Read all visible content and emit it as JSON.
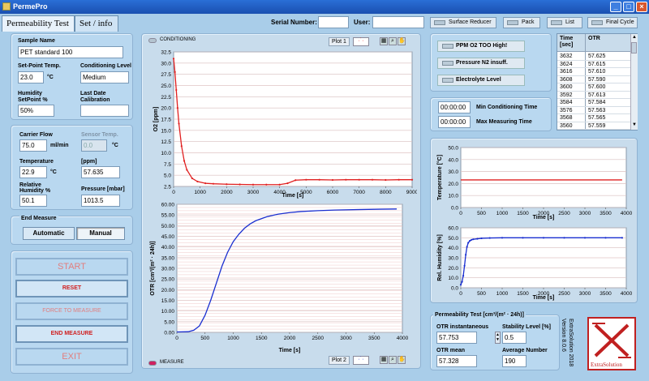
{
  "window": {
    "title": "PermePro"
  },
  "tabs": [
    {
      "label": "Permeability Test"
    },
    {
      "label": "Set / info"
    }
  ],
  "header": {
    "serial_label": "Serial Number:",
    "serial_value": "",
    "user_label": "User:",
    "user_value": "",
    "buttons": [
      {
        "label": "Surface Reducer"
      },
      {
        "label": "Pack"
      },
      {
        "label": "List"
      },
      {
        "label": "Final Cycle"
      }
    ]
  },
  "sample": {
    "name_label": "Sample Name",
    "name_value": "PET standard 100",
    "setpoint_label": "Set-Point Temp.",
    "setpoint_value": "23.0",
    "setpoint_unit": "°C",
    "cond_label": "Conditioning Level",
    "cond_value": "Medium",
    "humidity_label_1": "Humidity",
    "humidity_label_2": "SetPoint %",
    "humidity_value": "50%",
    "lastdate_label_1": "Last Date",
    "lastdate_label_2": "Calibration",
    "lastdate_value": ""
  },
  "carrier": {
    "flow_label": "Carrier Flow",
    "flow_value": "75.0",
    "flow_unit": "ml/min",
    "sensor_label": "Sensor Temp.",
    "sensor_value": "0.0",
    "sensor_unit": "°C",
    "temp_label": "Temperature",
    "temp_value": "22.9",
    "temp_unit": "°C",
    "ppm_label": "[ppm]",
    "ppm_value": "57.635",
    "rh_label_1": "Relative",
    "rh_label_2": "Humidity %",
    "rh_value": "50.1",
    "pressure_label": "Pressure [mbar]",
    "pressure_value": "1013.5"
  },
  "end_measure": {
    "title": "End Measure",
    "automatic": "Automatic",
    "manual": "Manual"
  },
  "actions": {
    "start": "START",
    "reset": "RESET",
    "force": "FORCE TO MEASURE",
    "end": "END MEASURE",
    "exit": "EXIT"
  },
  "plots": {
    "top_status": "CONDITIONING",
    "top_plot_label": "Plot 1",
    "bottom_status": "MEASURE",
    "bottom_plot_label": "Plot 2"
  },
  "alarms": [
    {
      "label": "PPM O2 TOO High!"
    },
    {
      "label": "Pressure N2 insuff."
    },
    {
      "label": "Electrolyte Level"
    }
  ],
  "times": {
    "min_cond_value": "00:00:00",
    "min_cond_label": "Min Conditioning Time",
    "max_meas_value": "00:00:00",
    "max_meas_label": "Max Measuring Time"
  },
  "otr_table": {
    "col_time_1": "Time",
    "col_time_2": "[sec]",
    "col_otr": "OTR",
    "rows": [
      [
        "3632",
        "57.625"
      ],
      [
        "3624",
        "57.615"
      ],
      [
        "3616",
        "57.610"
      ],
      [
        "3608",
        "57.590"
      ],
      [
        "3600",
        "57.600"
      ],
      [
        "3592",
        "57.613"
      ],
      [
        "3584",
        "57.584"
      ],
      [
        "3576",
        "57.563"
      ],
      [
        "3568",
        "57.565"
      ],
      [
        "3560",
        "57.559"
      ]
    ]
  },
  "result": {
    "title": "Permeability Test [cm³/(m² · 24h)]",
    "otr_inst_label": "OTR instantaneous",
    "otr_inst_value": "57.753",
    "stability_label": "Stability Level [%]",
    "stability_value": "0.5",
    "otr_mean_label": "OTR mean",
    "otr_mean_value": "57.328",
    "avg_label": "Average Number",
    "avg_value": "190"
  },
  "brand": {
    "name": "ExtraSolution",
    "version_text": "ExtraSolution 2018",
    "version_num": "Version 8.0.6"
  },
  "chart_data": [
    {
      "type": "scatter",
      "title": "",
      "xlabel": "Time [s]",
      "ylabel": "O2 [ppm]",
      "xlim": [
        0,
        9000
      ],
      "ylim": [
        2.5,
        32.5
      ],
      "xticks": [
        0,
        1000,
        2000,
        3000,
        4000,
        5000,
        6000,
        7000,
        8000,
        9000
      ],
      "yticks": [
        2.5,
        5.0,
        7.5,
        10.0,
        12.5,
        15.0,
        17.5,
        20.0,
        22.5,
        25.0,
        27.5,
        30.0,
        32.5
      ],
      "color": "#e02020",
      "x": [
        0,
        50,
        100,
        150,
        200,
        300,
        400,
        500,
        700,
        900,
        1200,
        1500,
        2000,
        2500,
        3000,
        3500,
        4000,
        4300,
        4600,
        5000,
        5500,
        6000,
        6500,
        7000,
        7500,
        8000,
        8500,
        9000
      ],
      "y": [
        31.0,
        28.0,
        24.0,
        20.0,
        16.5,
        11.5,
        8.2,
        6.2,
        4.3,
        3.6,
        3.2,
        3.1,
        3.0,
        2.95,
        2.9,
        2.9,
        2.9,
        3.2,
        3.9,
        4.0,
        4.0,
        3.95,
        4.0,
        4.0,
        4.0,
        3.95,
        4.0,
        4.0
      ]
    },
    {
      "type": "line",
      "title": "",
      "xlabel": "Time [s]",
      "ylabel": "OTR [cm³/(m² · 24h)]",
      "xlim": [
        0,
        4000
      ],
      "ylim": [
        0,
        60
      ],
      "xticks": [
        0,
        500,
        1000,
        1500,
        2000,
        2500,
        3000,
        3500,
        4000
      ],
      "yticks": [
        0.0,
        5.0,
        10.0,
        15.0,
        20.0,
        25.0,
        30.0,
        35.0,
        40.0,
        45.0,
        50.0,
        55.0,
        60.0
      ],
      "color": "#1a2fd0",
      "x": [
        0,
        200,
        300,
        400,
        500,
        600,
        700,
        800,
        900,
        1000,
        1100,
        1200,
        1300,
        1400,
        1600,
        1800,
        2000,
        2200,
        2500,
        2800,
        3200,
        3600,
        3900
      ],
      "y": [
        0.2,
        0.3,
        1.0,
        3.0,
        8.0,
        15.0,
        23.0,
        31.0,
        37.5,
        42.5,
        46.0,
        48.8,
        50.8,
        52.3,
        54.2,
        55.4,
        56.1,
        56.6,
        57.0,
        57.3,
        57.5,
        57.7,
        57.8
      ]
    },
    {
      "type": "line",
      "title": "",
      "xlabel": "Time [s]",
      "ylabel": "Temperature [°C]",
      "xlim": [
        0,
        4000
      ],
      "ylim": [
        0,
        50
      ],
      "xticks": [
        0,
        500,
        1000,
        1500,
        2000,
        2500,
        3000,
        3500,
        4000
      ],
      "yticks": [
        0.0,
        10.0,
        20.0,
        30.0,
        40.0,
        50.0
      ],
      "color": "#e02020",
      "x": [
        0,
        3900
      ],
      "y": [
        23.0,
        23.0
      ]
    },
    {
      "type": "scatter",
      "title": "",
      "xlabel": "Time [s]",
      "ylabel": "Rel. Humidity [%]",
      "xlim": [
        0,
        4000
      ],
      "ylim": [
        0,
        60
      ],
      "xticks": [
        0,
        500,
        1000,
        1500,
        2000,
        2500,
        3000,
        3500,
        4000
      ],
      "yticks": [
        0.0,
        10.0,
        20.0,
        30.0,
        40.0,
        50.0,
        60.0
      ],
      "color": "#1a2fd0",
      "x": [
        0,
        30,
        60,
        90,
        120,
        150,
        180,
        220,
        260,
        300,
        400,
        500,
        700,
        1000,
        1500,
        2000,
        2500,
        3000,
        3500,
        3900
      ],
      "y": [
        3,
        6,
        12,
        22,
        33,
        41,
        45,
        47,
        48,
        48.5,
        49,
        49.5,
        49.8,
        50,
        50,
        50,
        50,
        50,
        50,
        50
      ]
    }
  ]
}
